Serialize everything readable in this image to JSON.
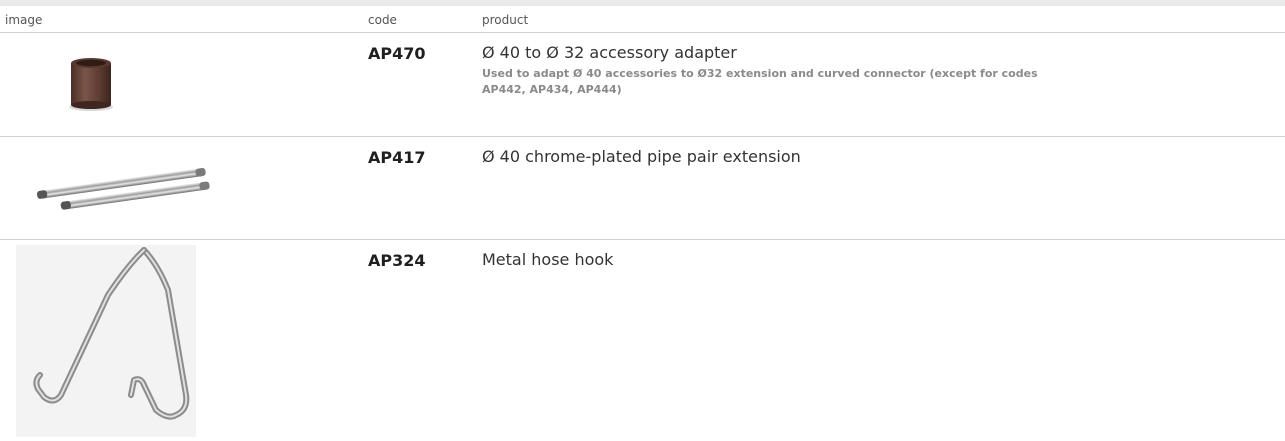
{
  "table": {
    "headers": {
      "image": "image",
      "code": "code",
      "product": "product"
    },
    "rows": [
      {
        "code": "AP470",
        "title": "Ø 40 to Ø 32 accessory adapter",
        "description": "Used to adapt Ø 40 accessories to Ø32 extension and curved connector (except for codes AP442, AP434, AP444)",
        "image_icon": "adapter-sleeve-icon"
      },
      {
        "code": "AP417",
        "title": "Ø 40 chrome-plated pipe pair extension",
        "description": "",
        "image_icon": "pipe-pair-icon"
      },
      {
        "code": "AP324",
        "title": "Metal hose hook",
        "description": "",
        "image_icon": "hose-hook-icon"
      }
    ]
  },
  "colors": {
    "header_band": "#e9e9e9",
    "row_divider": "#cfcfcf",
    "description_text": "#8a8a8a",
    "adapter_brown": "#6b4a3e"
  }
}
